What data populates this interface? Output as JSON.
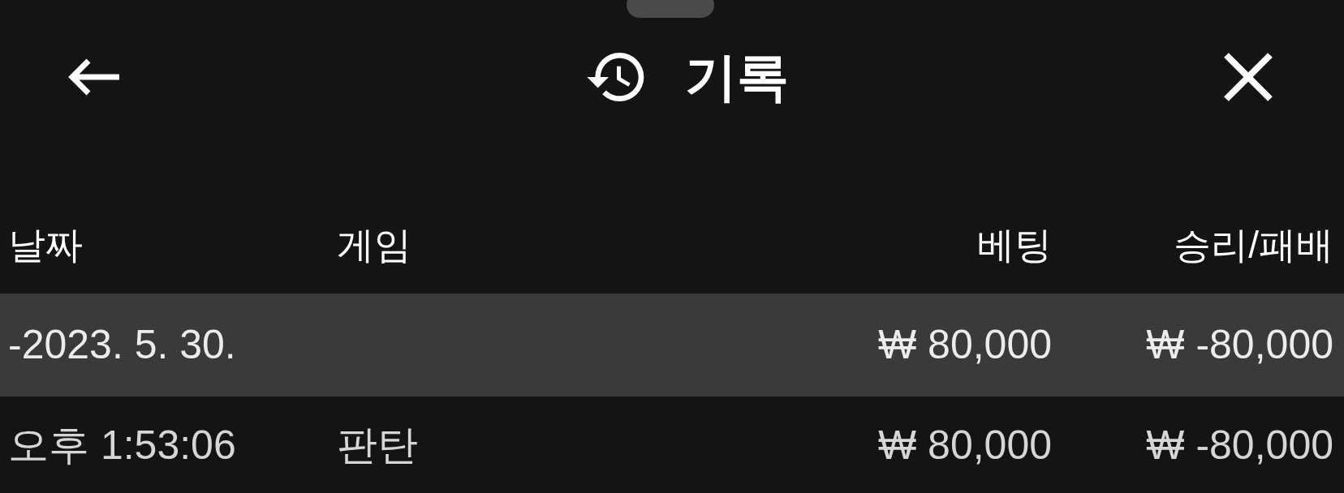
{
  "header": {
    "title": "기록"
  },
  "table": {
    "columns": [
      "날짜",
      "게임",
      "베팅",
      "승리/패배"
    ],
    "rows": [
      {
        "kind": "group",
        "cells": [
          "-2023. 5. 30.",
          "",
          "₩ 80,000",
          "₩ -80,000"
        ]
      },
      {
        "kind": "entry",
        "cells": [
          "오후 1:53:06",
          "판탄",
          "₩ 80,000",
          "₩ -80,000"
        ]
      }
    ]
  }
}
